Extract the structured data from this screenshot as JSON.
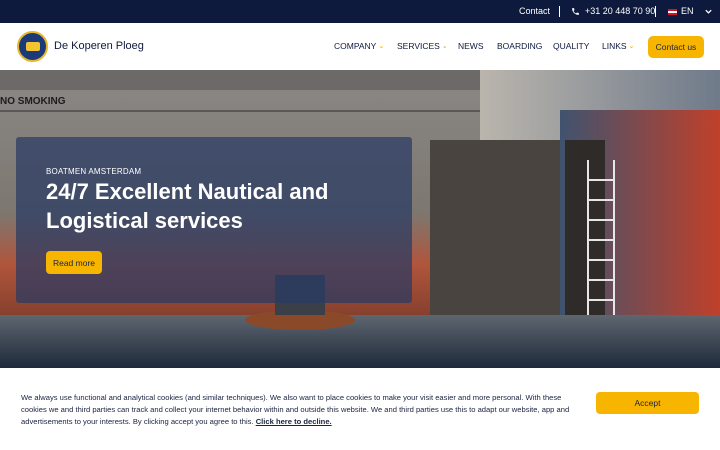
{
  "topbar": {
    "contact": "Contact",
    "separator": "|",
    "phone": "+31 20 448 70 90",
    "language": "EN",
    "phone_icon": "phone-icon",
    "flag_icon": "uk-flag-icon"
  },
  "header": {
    "brand": "De Koperen Ploeg",
    "nav": {
      "company": "COMPANY",
      "services": "SERVICES",
      "news": "NEWS",
      "boarding": "BOARDING",
      "quality": "QUALITY",
      "links": "LINKS"
    },
    "contact_button": "Contact us"
  },
  "hero": {
    "eyebrow": "BOATMEN AMSTERDAM",
    "title": "24/7 Excellent Nautical and Logistical services",
    "read_more": "Read more",
    "ship_text": "NO SMOKING"
  },
  "cookie": {
    "text": "We always use functional and analytical cookies (and similar techniques). We also want to place cookies to make your visit easier and more personal. With these cookies we and third parties can track and collect your internet behavior within and outside this website. We and third parties use this to adapt our website, app and advertisements to your interests. By clicking accept you agree to this.",
    "decline_link": "Click here to decline.",
    "accept_button": "Accept"
  },
  "colors": {
    "navy": "#0e1a3d",
    "accent": "#f7b500"
  }
}
